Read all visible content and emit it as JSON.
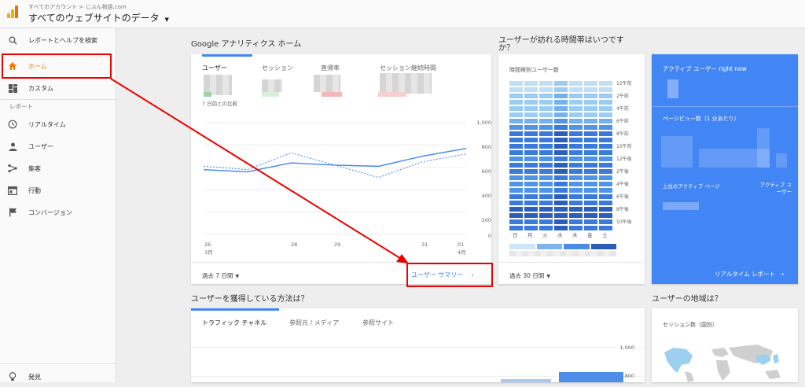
{
  "header": {
    "breadcrumb": "すべてのアカウント > じぶん物語.com",
    "view_title": "すべてのウェブサイトのデータ",
    "view_dropdown_icon": "caret-down-icon"
  },
  "sidebar": {
    "search": "レポートとヘルプを検索",
    "home": "ホーム",
    "custom": "カスタム",
    "reports_heading": "レポート",
    "realtime": "リアルタイム",
    "users": "ユーザー",
    "acquisition": "集客",
    "behavior": "行動",
    "conversions": "コンバージョン",
    "discover": "発見"
  },
  "home_section": {
    "title": "Google アナリティクス ホーム",
    "tabs": [
      "ユーザー",
      "セッション",
      "直帰率",
      "セッション継続時間"
    ],
    "comparison": "7 日前との比較",
    "y_ticks": [
      "1,000",
      "800",
      "600",
      "400",
      "200",
      "0"
    ],
    "x_ticks": [
      "26",
      "3月",
      "28",
      "29",
      "31",
      "01",
      "4月"
    ],
    "date_range": "過去 7 日間",
    "summary_link": "ユーザー サマリー"
  },
  "chart_data": {
    "type": "line",
    "x": [
      "3月26日",
      "3月27日",
      "3月28日",
      "3月29日",
      "3月30日",
      "3月31日",
      "4月1日"
    ],
    "ylim": [
      0,
      1000
    ],
    "series": [
      {
        "values": [
          580,
          560,
          640,
          620,
          610,
          700,
          770
        ]
      },
      {
        "values": [
          610,
          580,
          730,
          620,
          510,
          650,
          720
        ]
      }
    ],
    "colors": [
      "#4285f4",
      "#4285f4"
    ]
  },
  "time_section": {
    "title_line1": "ユーザーが訪れる時間帯はいつです",
    "title_line2": "か？",
    "card_title": "時間帯別ユーザー数",
    "hour_labels": [
      "12午前",
      "2午前",
      "4午前",
      "6午前",
      "8午前",
      "10午前",
      "12午後",
      "2午後",
      "4午後",
      "6午後",
      "8午後",
      "10午後"
    ],
    "days": [
      "日",
      "月",
      "火",
      "水",
      "木",
      "金",
      "土"
    ],
    "date_range": "過去 30 日間"
  },
  "active_users": {
    "title": "アクティブ ユーザー right now",
    "pageviews_label": "ページビュー数（1 分あたり）",
    "top_pages_label": "上位のアクティブ ページ",
    "active_users_col_line1": "アクティブ ユ",
    "active_users_col_line2": "ーザー",
    "realtime_link": "リアルタイム レポート"
  },
  "acquisition": {
    "title": "ユーザーを獲得している方法は？",
    "tabs": [
      "トラフィック チャネル",
      "参照元 / メディア",
      "参照サイト"
    ],
    "y_ticks": [
      "1,000",
      "800"
    ]
  },
  "geo": {
    "title": "ユーザーの地域は？",
    "card_title": "セッション数（国別）"
  },
  "colors": {
    "accent": "#4285f4",
    "home_active": "#f57c00",
    "annotation": "#e00000"
  }
}
